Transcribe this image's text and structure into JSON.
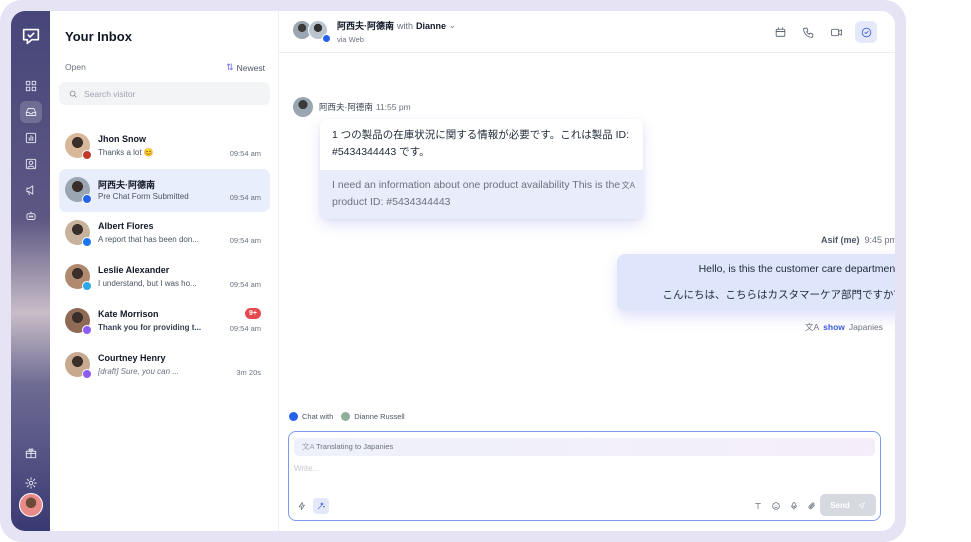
{
  "inbox": {
    "title": "Your Inbox",
    "filter": "Open",
    "sort": "Newest",
    "search_placeholder": "Search visitor",
    "conversations": [
      {
        "name": "Jhon Snow",
        "preview": "Thanks a lot 😊",
        "time": "09:54 am",
        "source": "instagram",
        "color": "#c0392b"
      },
      {
        "name": "阿西夫·阿德南",
        "preview": "Pre Chat Form Submitted",
        "time": "09:54 am",
        "source": "web",
        "color": "#2563eb",
        "selected": true
      },
      {
        "name": "Albert Flores",
        "preview": "A report that has been don...",
        "time": "09:54 am",
        "source": "facebook",
        "color": "#1877f2"
      },
      {
        "name": "Leslie Alexander",
        "preview": "I understand, but I was ho...",
        "time": "09:54 am",
        "source": "telegram",
        "color": "#29a9eb"
      },
      {
        "name": "Kate Morrison",
        "preview": "Thank you for providing t...",
        "time": "09:54 am",
        "source": "messenger",
        "color": "#8b5cf6",
        "badge": "9+"
      },
      {
        "name": "Courtney Henry",
        "preview": "[draft] Sure, you can ...",
        "time": "3m 20s",
        "source": "messenger",
        "color": "#8b5cf6"
      }
    ]
  },
  "chat": {
    "header": {
      "name": "阿西夫·阿德南",
      "with": "with",
      "agent": "Dianne",
      "via": "via Web"
    },
    "incoming": {
      "sender": "阿西夫·阿德南",
      "time": "11:55 pm",
      "original": "1 つの製品の在庫状況に関する情報が必要です。これは製品 ID: #5434344443 です。",
      "translation": "I need an information about one product availability This is the product ID: #5434344443"
    },
    "outgoing": {
      "sender": "Asif (me)",
      "time": "9:45 pm",
      "line1": "Hello, is this the customer care department?",
      "line2": "こんにちは、こちらはカスタマーケア部門ですか？",
      "show": "show",
      "language": "Japanies"
    },
    "composer": {
      "chat_with": "Chat with",
      "recipient": "Dianne Russell",
      "translating": "Translating to Japanies",
      "placeholder": "Write...",
      "send": "Send"
    }
  },
  "icons": {
    "rail": [
      "logo-chat-icon",
      "grid-icon",
      "inbox-icon",
      "chart-icon",
      "contacts-icon",
      "broadcast-icon",
      "bot-icon",
      "gift-icon",
      "settings-icon"
    ],
    "header_actions": [
      "window-icon",
      "phone-icon",
      "video-icon",
      "chat-active-icon"
    ]
  }
}
